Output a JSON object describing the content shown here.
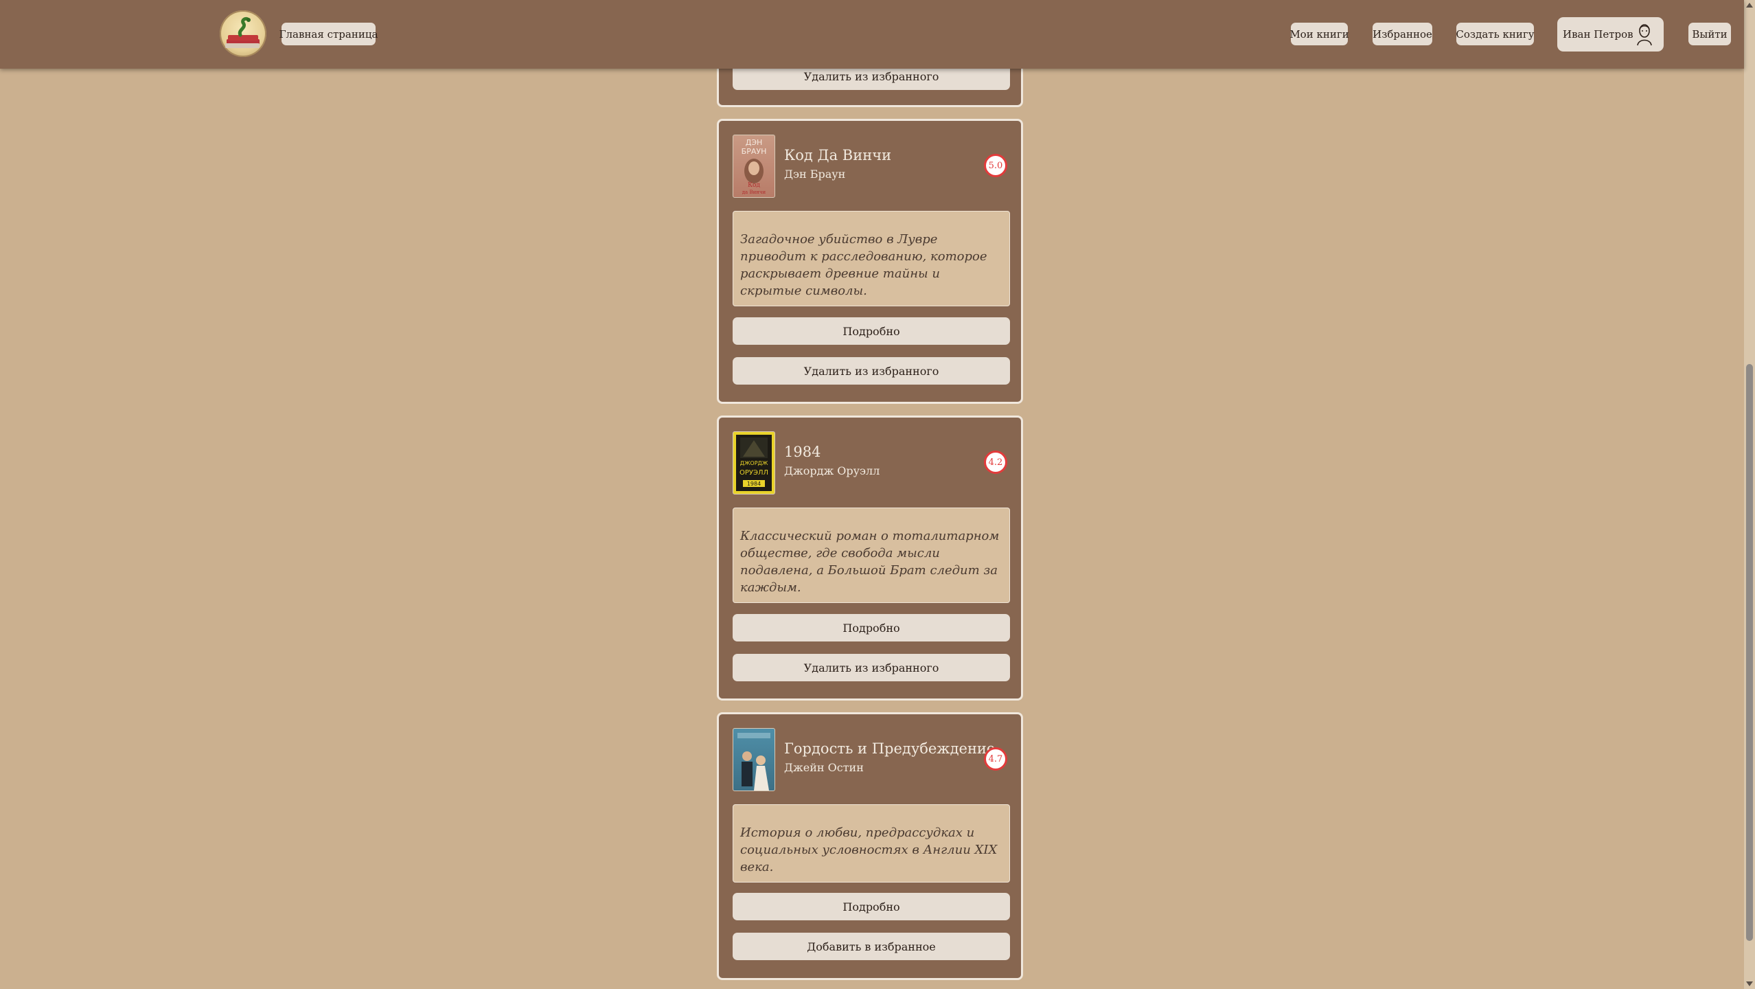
{
  "header": {
    "home_label": "Главная страница",
    "my_books_label": "Мои книги",
    "favorites_label": "Избранное",
    "create_book_label": "Создать книгу",
    "user_name": "Иван Петров",
    "logout_label": "Выйти"
  },
  "cards": [
    {
      "remove_label": "Удалить из избранного"
    },
    {
      "title": "Код Да Винчи",
      "author": "Дэн Браун",
      "rating": "5.0",
      "description": "Загадочное убийство в Лувре приводит к расследованию, которое раскрывает древние тайны и скрытые символы.",
      "details_label": "Подробно",
      "action_label": "Удалить из избранного",
      "cover_text": [
        "ДЭН",
        "БРАУН",
        "Код",
        "да Винчи"
      ]
    },
    {
      "title": "1984",
      "author": "Джордж Оруэлл",
      "rating": "4.2",
      "description": "Классический роман о тоталитарном обществе, где свобода мысли подавлена, а Большой Брат следит за каждым.",
      "details_label": "Подробно",
      "action_label": "Удалить из избранного",
      "cover_text": [
        "ДЖОРДЖ",
        "ОРУЭЛЛ",
        "1984"
      ]
    },
    {
      "title": "Гордость и Предубеждение",
      "author": "Джейн Остин",
      "rating": "4.7",
      "description": "История о любви, предрассудках и социальных условностях в Англии XIX века.",
      "details_label": "Подробно",
      "action_label": "Добавить в избранное"
    }
  ],
  "colors": {
    "background": "#cbb08f",
    "header": "#876650",
    "card": "#876650",
    "button": "#e6ddd3",
    "rating_accent": "#e23b3b"
  },
  "icons": {
    "logo": "book-stack-snake-logo",
    "avatar": "user-avatar-icon"
  }
}
